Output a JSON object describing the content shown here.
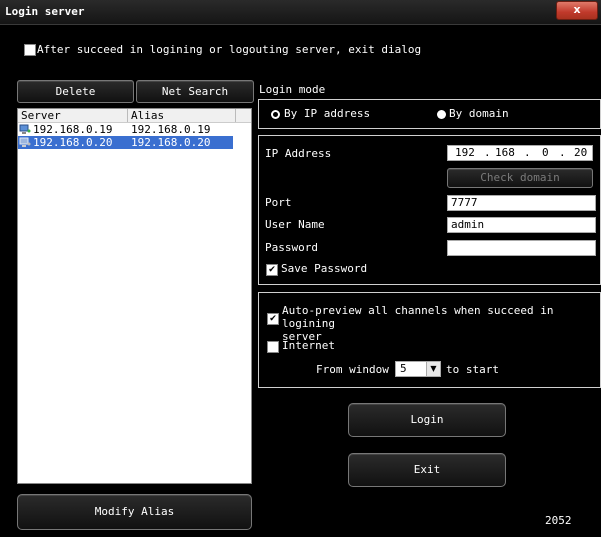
{
  "window": {
    "title": "Login server",
    "close_label": "x"
  },
  "exit_option": {
    "label": "After succeed in logining or logouting server, exit dialog",
    "checked": false
  },
  "toolbar": {
    "delete_label": "Delete",
    "net_search_label": "Net Search"
  },
  "server_list": {
    "columns": [
      "Server",
      "Alias"
    ],
    "rows": [
      {
        "server": "192.168.0.19",
        "alias": "192.168.0.19",
        "selected": false
      },
      {
        "server": "192.168.0.20",
        "alias": "192.168.0.20",
        "selected": true
      }
    ]
  },
  "modify_alias_label": "Modify Alias",
  "login_mode": {
    "label": "Login mode",
    "by_ip_label": "By IP address",
    "by_domain_label": "By domain",
    "selected": "By IP address"
  },
  "connection": {
    "ip_label": "IP Address",
    "ip_octets": [
      "192",
      "168",
      "0",
      "20"
    ],
    "check_domain_label": "Check domain",
    "port_label": "Port",
    "port_value": "7777",
    "username_label": "User Name",
    "username_value": "admin",
    "password_label": "Password",
    "password_value": "",
    "save_password_label": "Save Password",
    "save_password_checked": true
  },
  "preview": {
    "auto_preview_label_line1": "Auto-preview all channels when succeed in logining",
    "auto_preview_label_line2": "server",
    "auto_preview_checked": true,
    "internet_label": "Internet",
    "internet_checked": false,
    "from_window_label": "From window",
    "window_value": "5",
    "to_start_label": "to start"
  },
  "actions": {
    "login_label": "Login",
    "exit_label": "Exit"
  },
  "status_code": "2052"
}
